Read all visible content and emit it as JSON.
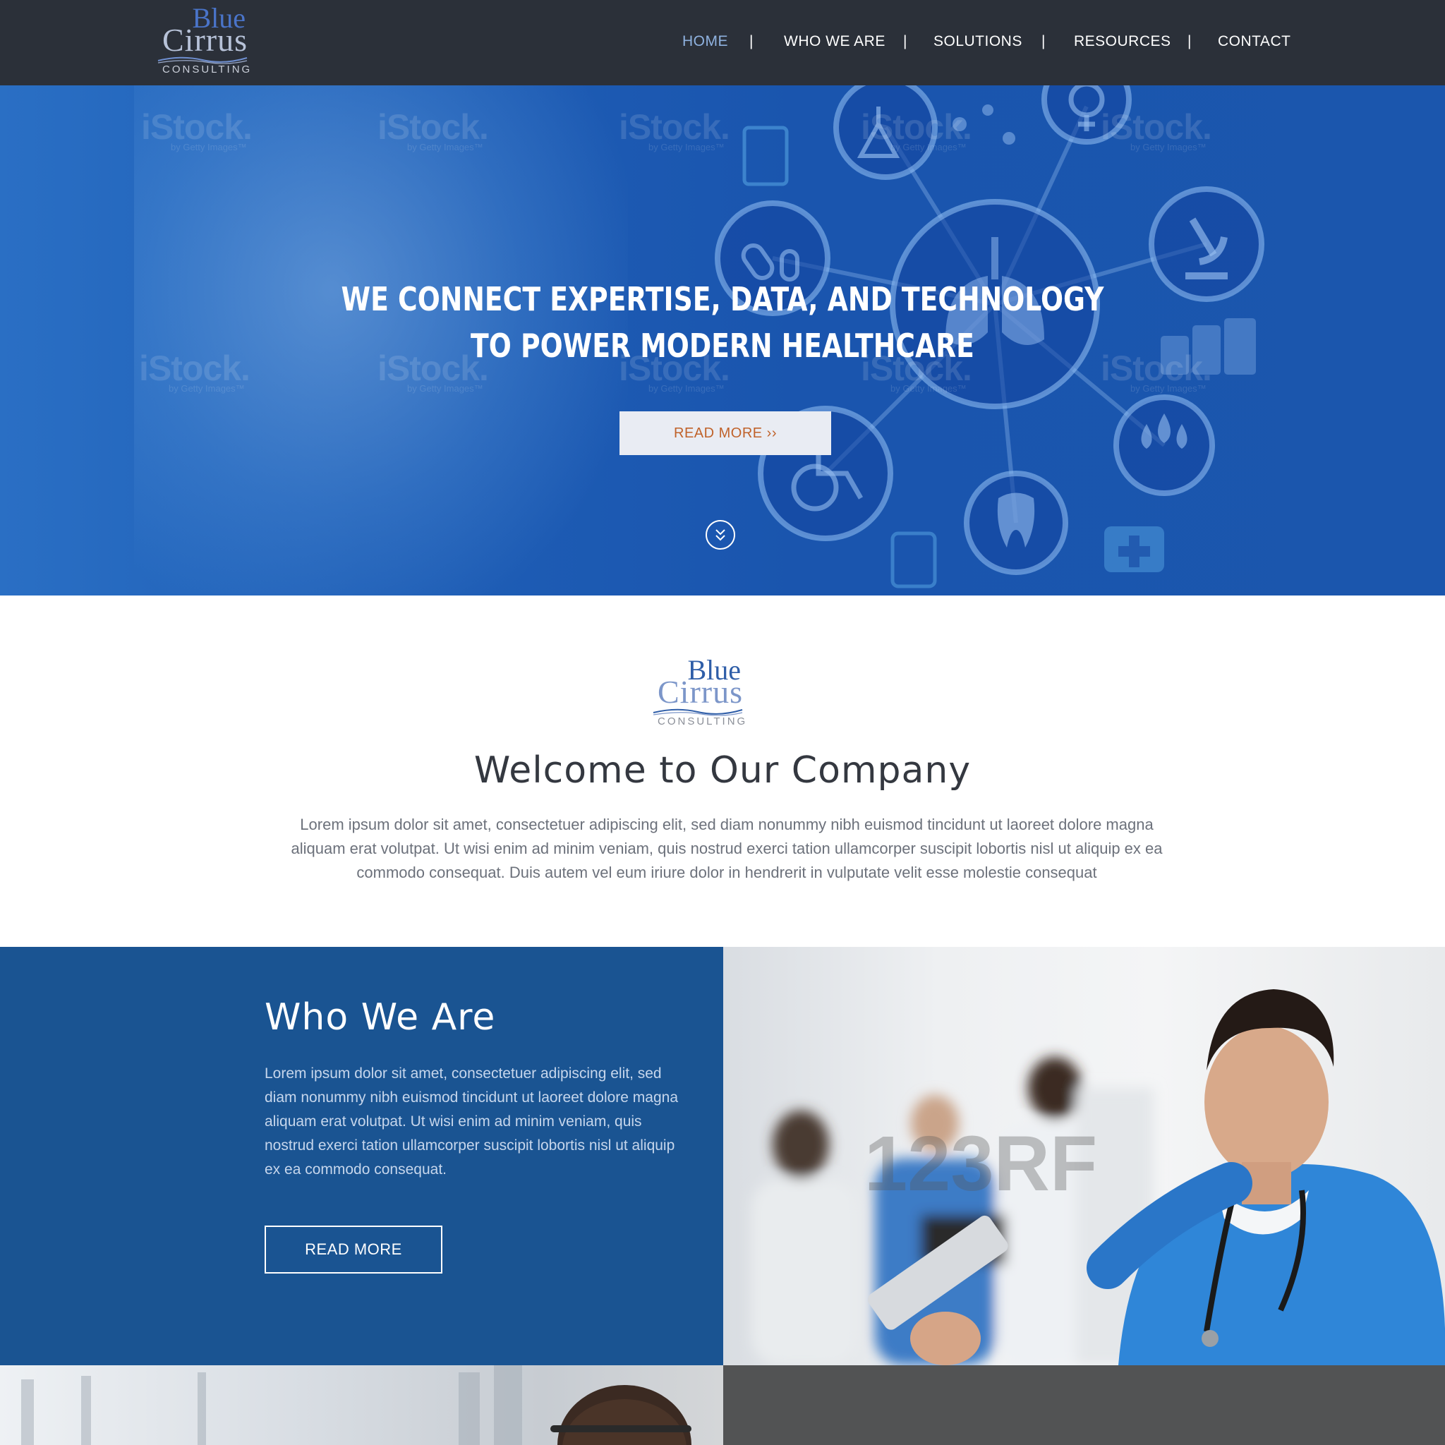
{
  "brand": {
    "logo_word1": "Blue",
    "logo_word2": "Cirrus",
    "logo_word3": "CONSULTING"
  },
  "nav": {
    "items": [
      {
        "label": "HOME",
        "active": true
      },
      {
        "label": "WHO WE ARE",
        "active": false
      },
      {
        "label": "SOLUTIONS",
        "active": false
      },
      {
        "label": "RESOURCES",
        "active": false
      },
      {
        "label": "CONTACT",
        "active": false
      }
    ],
    "separator": "|"
  },
  "hero": {
    "title_line1": "WE CONNECT EXPERTISE, DATA, AND TECHNOLOGY",
    "title_line2": "TO POWER MODERN HEALTHCARE",
    "button_label": "READ MORE ››",
    "watermark_main": "iStock.",
    "watermark_sub": "by Getty Images™"
  },
  "welcome": {
    "title": "Welcome to Our Company",
    "text": "Lorem ipsum dolor sit amet, consectetuer adipiscing elit, sed diam nonummy nibh euismod tincidunt ut laoreet dolore magna aliquam erat volutpat. Ut wisi enim ad minim veniam, quis nostrud exerci tation ullamcorper suscipit lobortis nisl ut aliquip ex ea commodo consequat. Duis autem vel eum iriure dolor in hendrerit in vulputate velit esse molestie consequat"
  },
  "who": {
    "title": "Who We Are",
    "text": "Lorem ipsum dolor sit amet, consectetuer adipiscing elit, sed diam nonummy nibh euismod tincidunt ut laoreet dolore magna aliquam erat volutpat. Ut wisi enim ad minim veniam, quis nostrud exerci tation ullamcorper suscipit lobortis nisl ut aliquip ex ea commodo consequat.",
    "button_label": "READ MORE",
    "photo_watermark": "123RF"
  },
  "colors": {
    "header_bg": "#2b3039",
    "nav_active": "#8fb2e0",
    "hero_blue": "#1b56ad",
    "hero_button_text": "#c0622a",
    "who_bg": "#1a5492",
    "bottom_right_bg": "#525354"
  }
}
